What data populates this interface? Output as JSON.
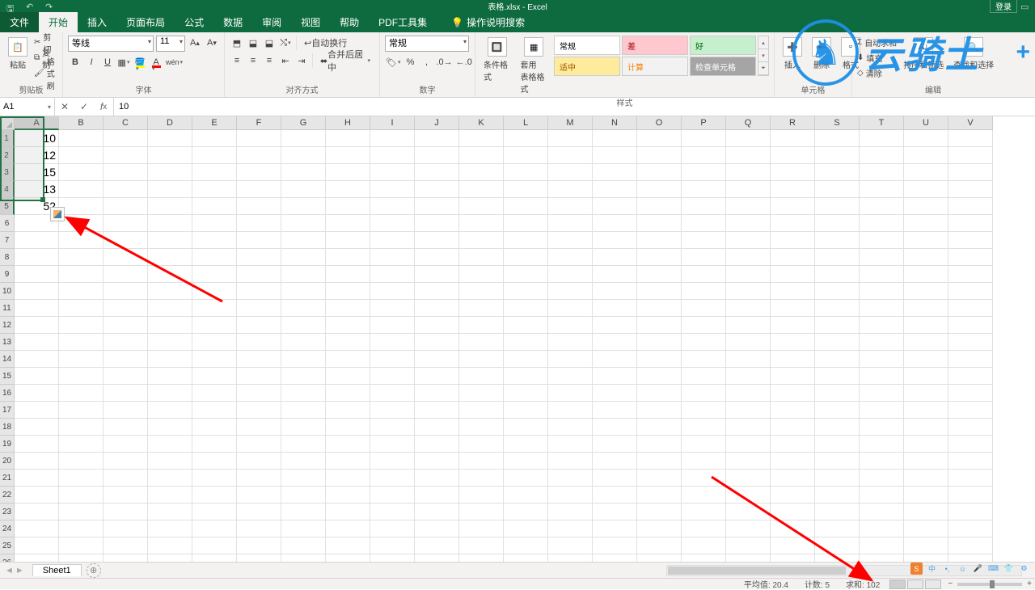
{
  "title": "表格.xlsx - Excel",
  "login": "登录",
  "tabs": [
    "文件",
    "开始",
    "插入",
    "页面布局",
    "公式",
    "数据",
    "审阅",
    "视图",
    "帮助",
    "PDF工具集"
  ],
  "help_search": "操作说明搜索",
  "clipboard": {
    "paste": "粘贴",
    "cut": "剪切",
    "copy": "复制",
    "painter": "格式刷",
    "label": "剪贴板"
  },
  "font": {
    "name": "等线",
    "size": "11",
    "label": "字体"
  },
  "align": {
    "wrap": "自动换行",
    "merge": "合并后居中",
    "label": "对齐方式"
  },
  "number": {
    "format": "常规",
    "label": "数字"
  },
  "styles": {
    "cond": "条件格式",
    "table": "套用\n表格格式",
    "label": "样式",
    "gallery": [
      "常规",
      "差",
      "好",
      "适中",
      "计算",
      "检查单元格"
    ]
  },
  "cells": {
    "insert": "插入",
    "delete": "删除",
    "format": "格式",
    "label": "单元格"
  },
  "editing": {
    "sum": "自动求和",
    "fill": "填充",
    "clear": "清除",
    "sort": "排序和筛选",
    "find": "查找和选择",
    "label": "编辑"
  },
  "namebox": "A1",
  "formula": "10",
  "columns": [
    "A",
    "B",
    "C",
    "D",
    "E",
    "F",
    "G",
    "H",
    "I",
    "J",
    "K",
    "L",
    "M",
    "N",
    "O",
    "P",
    "Q",
    "R",
    "S",
    "T",
    "U",
    "V"
  ],
  "cell_data": [
    "10",
    "12",
    "15",
    "13",
    "52"
  ],
  "sheet": "Sheet1",
  "status": {
    "avg_lbl": "平均值:",
    "avg": "20.4",
    "cnt_lbl": "计数:",
    "cnt": "5",
    "sum_lbl": "求和:",
    "sum": "102"
  },
  "watermark": "云骑士",
  "ime_s": "S",
  "ime_zh": "中"
}
